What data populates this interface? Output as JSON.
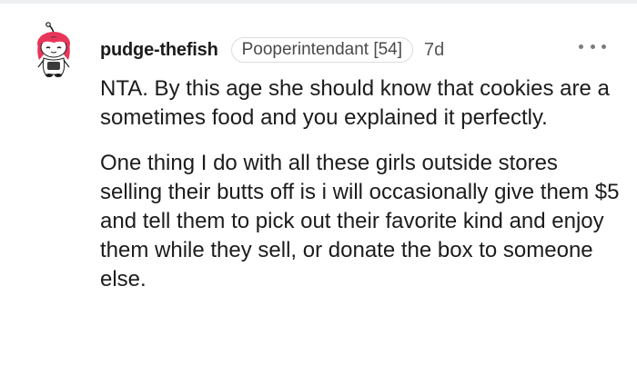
{
  "comment": {
    "author": "pudge-thefish",
    "flair": "Pooperintendant [54]",
    "age": "7d",
    "paragraphs": [
      "NTA. By this age she should know that cookies are a sometimes food and you explained it perfectly.",
      "One thing I do with all these girls outside stores selling their butts off is i will occasionally give them $5 and tell them to pick out their favorite kind and enjoy them while they sell, or donate the box to someone else."
    ],
    "more_icon": "ellipsis-horizontal-icon",
    "avatar_icon": "snoo-avatar-icon"
  },
  "colors": {
    "text": "#1c1c1c",
    "meta": "#555555",
    "flair_border": "#d9dcdf",
    "avatar_hair": "#e8355a",
    "divider": "#edeff1"
  }
}
